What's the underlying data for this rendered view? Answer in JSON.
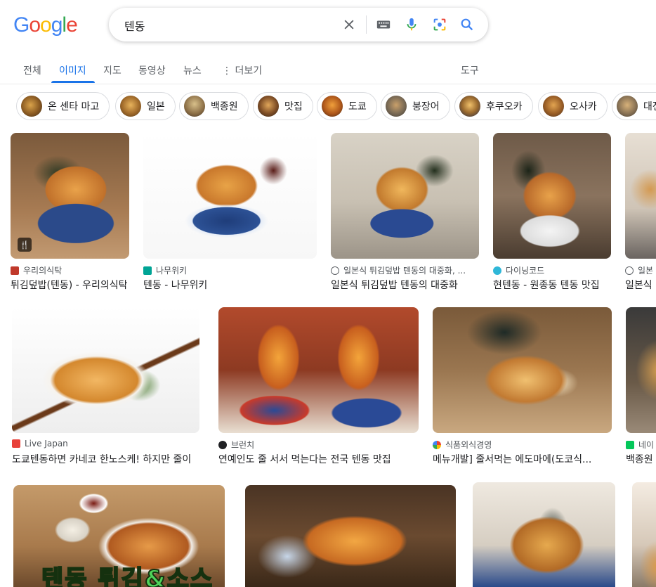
{
  "logo": {
    "text": [
      "G",
      "o",
      "o",
      "g",
      "l",
      "e"
    ]
  },
  "search": {
    "query": "텐동"
  },
  "tabs": [
    {
      "label": "전체"
    },
    {
      "label": "이미지"
    },
    {
      "label": "지도"
    },
    {
      "label": "동영상"
    },
    {
      "label": "뉴스"
    },
    {
      "label": "⋮ 더보기"
    },
    {
      "label": "도구"
    }
  ],
  "chips": [
    {
      "label": "온 센타 마고"
    },
    {
      "label": "일본"
    },
    {
      "label": "백종원"
    },
    {
      "label": "맛집"
    },
    {
      "label": "도쿄"
    },
    {
      "label": "붕장어"
    },
    {
      "label": "후쿠오카"
    },
    {
      "label": "오사카"
    },
    {
      "label": "대전"
    }
  ],
  "results": [
    {
      "source": "우리의식탁",
      "title": "튀김덮밥(텐동) - 우리의식탁",
      "badge": "🍴"
    },
    {
      "source": "나무위키",
      "title": "텐동 - 나무위키"
    },
    {
      "source": "일본식 튀김덮밥 텐동의 대중화, ...",
      "title": "일본식 튀김덮밥 텐동의 대중화"
    },
    {
      "source": "다이닝코드",
      "title": "현텐동 - 원종동 텐동 맛집"
    },
    {
      "source": "일본",
      "title": "일본식"
    },
    {
      "source": "Live Japan",
      "title": "도쿄텐동하면 카네코 한노스케! 하지만 줄이"
    },
    {
      "source": "브런치",
      "title": "연예인도 줄 서서 먹는다는 전국 텐동 맛집"
    },
    {
      "source": "식품외식경영",
      "title": "메뉴개발] 줄서먹는 에도마에(도코식..."
    },
    {
      "source": "네이",
      "title": "백종원"
    },
    {
      "source": "",
      "title": "",
      "overlay": "텐동 튀김&소스"
    },
    {
      "source": "",
      "title": ""
    },
    {
      "source": "",
      "title": ""
    },
    {
      "source": "",
      "title": ""
    }
  ],
  "colors": {
    "accent": "#1a73e8",
    "text_primary": "#202124",
    "text_secondary": "#5f6368",
    "border": "#dadce0"
  }
}
